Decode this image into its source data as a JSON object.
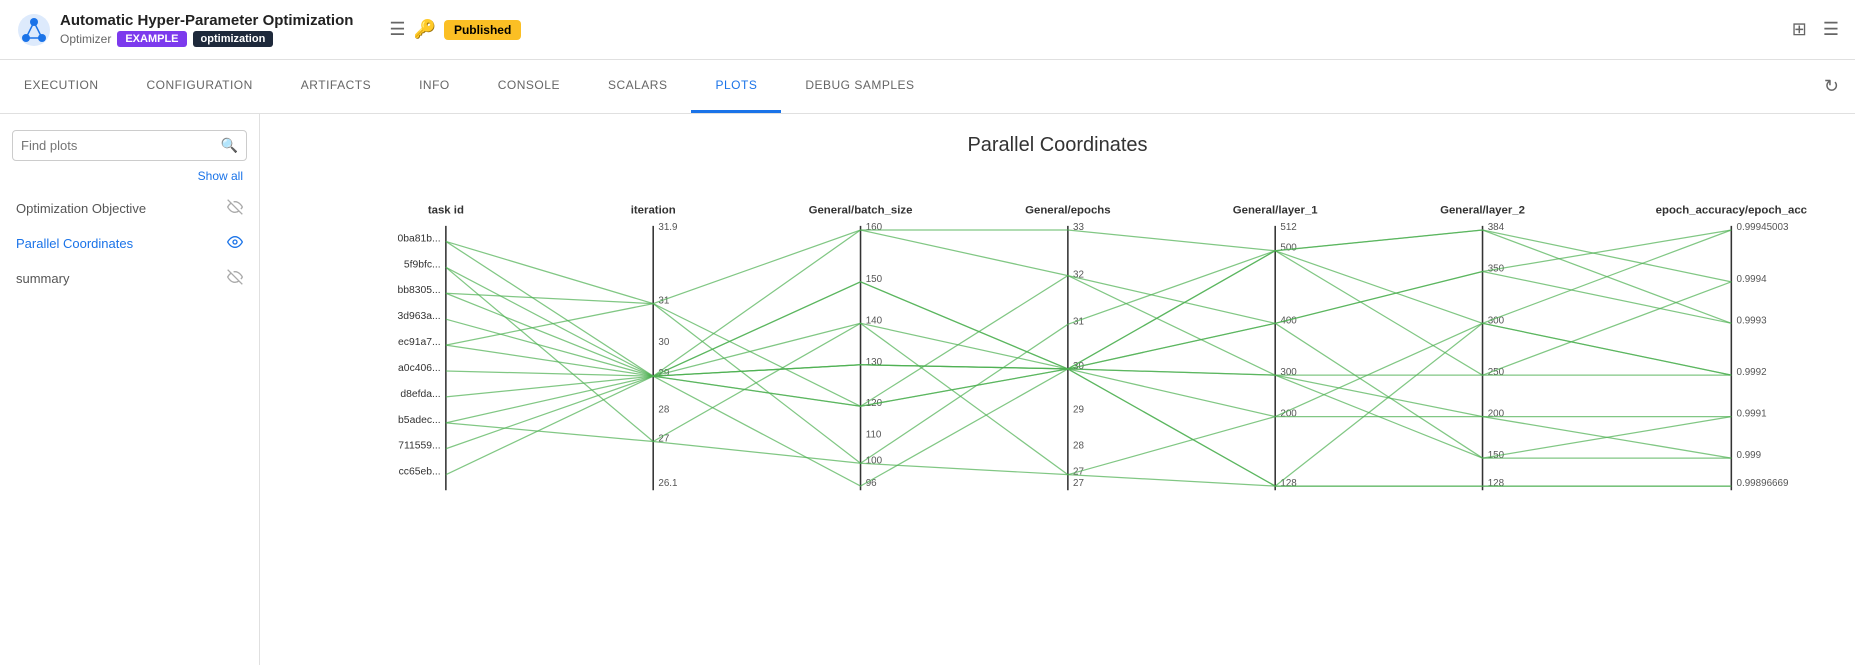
{
  "app": {
    "title": "Automatic Hyper-Parameter Optimization",
    "subtitle": "Optimizer",
    "tags": [
      "EXAMPLE",
      "optimization"
    ],
    "status": "Published"
  },
  "nav": {
    "tabs": [
      {
        "label": "EXECUTION",
        "active": false
      },
      {
        "label": "CONFIGURATION",
        "active": false
      },
      {
        "label": "ARTIFACTS",
        "active": false
      },
      {
        "label": "INFO",
        "active": false
      },
      {
        "label": "CONSOLE",
        "active": false
      },
      {
        "label": "SCALARS",
        "active": false
      },
      {
        "label": "PLOTS",
        "active": true
      },
      {
        "label": "DEBUG SAMPLES",
        "active": false
      }
    ]
  },
  "sidebar": {
    "search_placeholder": "Find plots",
    "show_all": "Show all",
    "items": [
      {
        "label": "Optimization Objective",
        "active": false,
        "visible": false
      },
      {
        "label": "Parallel Coordinates",
        "active": true,
        "visible": true
      },
      {
        "label": "summary",
        "active": false,
        "visible": false
      }
    ]
  },
  "plot": {
    "title": "Parallel Coordinates",
    "axes": [
      {
        "name": "task id",
        "max_label": "",
        "min_label": "",
        "task_labels": [
          "0ba81b...",
          "5f9bfc...",
          "bb8305...",
          "3d963a...",
          "ec91a7...",
          "a0c406...",
          "d8efda...",
          "b5adec...",
          "711559...",
          "cc65eb..."
        ]
      },
      {
        "name": "iteration",
        "max": 31.9,
        "values": [
          31,
          30,
          29,
          28,
          27,
          26.1
        ]
      },
      {
        "name": "General/batch_size",
        "max": 160,
        "values": [
          150,
          140,
          130,
          120,
          110,
          100,
          96
        ]
      },
      {
        "name": "General/epochs",
        "max": 33,
        "values": [
          32,
          31,
          30,
          29,
          28,
          27
        ]
      },
      {
        "name": "General/layer_1",
        "max": 512,
        "values": [
          500,
          400,
          300,
          200,
          128
        ]
      },
      {
        "name": "General/layer_2",
        "max": 384,
        "values": [
          350,
          300,
          250,
          200,
          150,
          128
        ]
      },
      {
        "name": "epoch_accuracy/epoch_acc",
        "max": 0.99945003,
        "values": [
          0.9994,
          0.9993,
          0.9992,
          0.9991,
          0.999,
          0.99896669
        ]
      }
    ]
  },
  "icons": {
    "search": "🔍",
    "eye": "👁",
    "eye_off": "🚫",
    "refresh": "↻",
    "layout": "⊞",
    "menu": "☰",
    "id": "🔑"
  }
}
